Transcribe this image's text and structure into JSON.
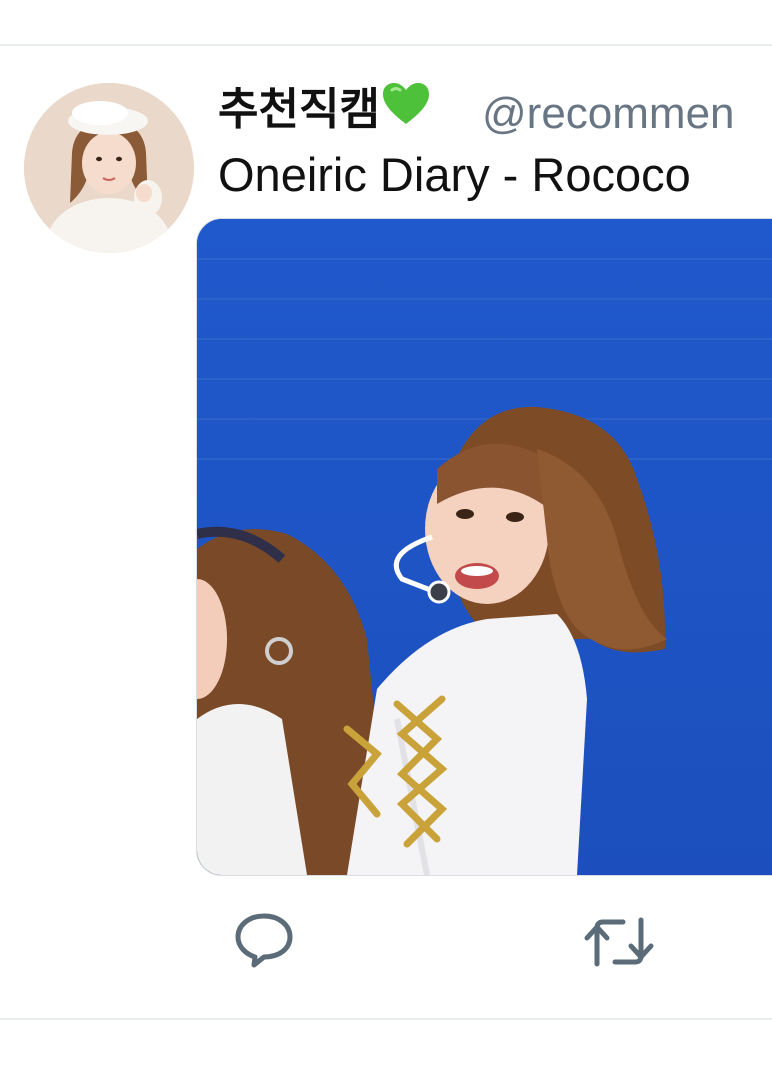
{
  "tweet": {
    "display_name": "추천직캠",
    "name_emoji": "green-heart",
    "handle": "@recommen",
    "text": "Oneiric Diary - Rococo"
  },
  "actions": {
    "reply_icon": "speech-bubble-icon",
    "retweet_icon": "retweet-arrows-icon"
  },
  "colors": {
    "name": "#111111",
    "handle": "#687684",
    "icon": "#5b6b78",
    "media_background": "#1f57c7",
    "divider": "#e8ecee",
    "heart": "#4ec13b"
  }
}
